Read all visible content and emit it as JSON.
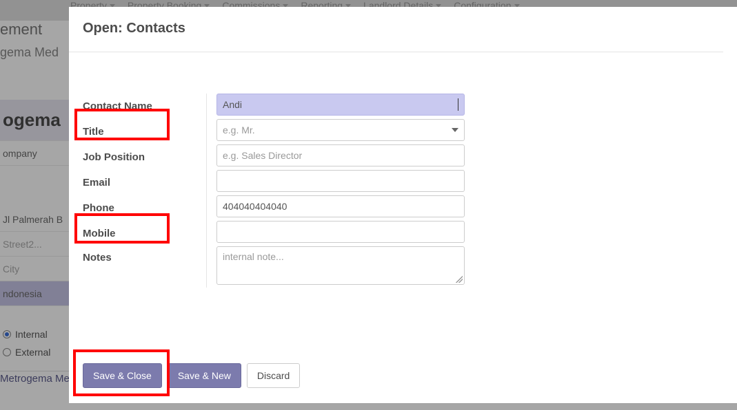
{
  "topnav": {
    "items": [
      "Property",
      "Property Booking",
      "Commissions",
      "Reporting",
      "Landlord Details",
      "Configuration"
    ]
  },
  "bg": {
    "truncated_title": "ement",
    "truncated_sub": "gema Med",
    "company_big": "ogema",
    "company_label": "ompany",
    "street1": "Jl Palmerah B",
    "street2_ph": "Street2...",
    "city_ph": "City",
    "country": "ndonesia",
    "radio_internal": "Internal",
    "radio_external": "External",
    "footer_company": "Metrogema Media Nusantara"
  },
  "modal": {
    "title": "Open: Contacts",
    "labels": {
      "contact_name": "Contact Name",
      "title": "Title",
      "job": "Job Position",
      "email": "Email",
      "phone": "Phone",
      "mobile": "Mobile",
      "notes": "Notes"
    },
    "fields": {
      "name": "Andi",
      "title_ph": "e.g. Mr.",
      "job_ph": "e.g. Sales Director",
      "email": "",
      "phone": "404040404040",
      "mobile": "",
      "notes_ph": "internal note..."
    },
    "buttons": {
      "save_close": "Save & Close",
      "save_new": "Save & New",
      "discard": "Discard"
    }
  }
}
